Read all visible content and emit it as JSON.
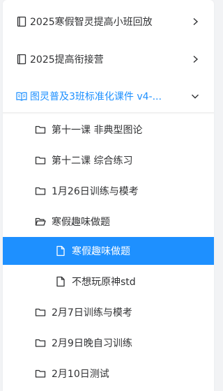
{
  "courses": [
    {
      "label": "2025寒假智灵提高小班回放",
      "expanded": false
    },
    {
      "label": "2025提高衔接营",
      "expanded": false
    },
    {
      "label": "图灵普及3班标准化课件 v4-...",
      "expanded": true
    }
  ],
  "tree": [
    {
      "label": " 第十一课 非典型图论",
      "type": "folder",
      "level": 1
    },
    {
      "label": " 第十二课 综合练习",
      "type": "folder",
      "level": 1
    },
    {
      "label": "1月26日训练与模考",
      "type": "folder",
      "level": 1
    },
    {
      "label": "寒假趣味做题",
      "type": "folder-open",
      "level": 1
    },
    {
      "label": "寒假趣味做题",
      "type": "file",
      "level": 2,
      "selected": true
    },
    {
      "label": "不想玩原神std",
      "type": "file",
      "level": 2
    },
    {
      "label": "2月7日训练与模考",
      "type": "folder",
      "level": 1
    },
    {
      "label": "2月9日晚自习训练",
      "type": "folder",
      "level": 1
    },
    {
      "label": "2月10日测试",
      "type": "folder",
      "level": 1
    }
  ],
  "colors": {
    "accent": "#1e90ff",
    "text": "#303133",
    "background": "#f2f3f5"
  },
  "icons": {
    "course_collapsed": "notebook-icon",
    "course_expanded": "open-book-icon",
    "folder": "folder-icon",
    "folder_open": "folder-open-icon",
    "file": "file-icon",
    "chevron_right": "chevron-right-icon",
    "chevron_down": "chevron-down-icon"
  }
}
